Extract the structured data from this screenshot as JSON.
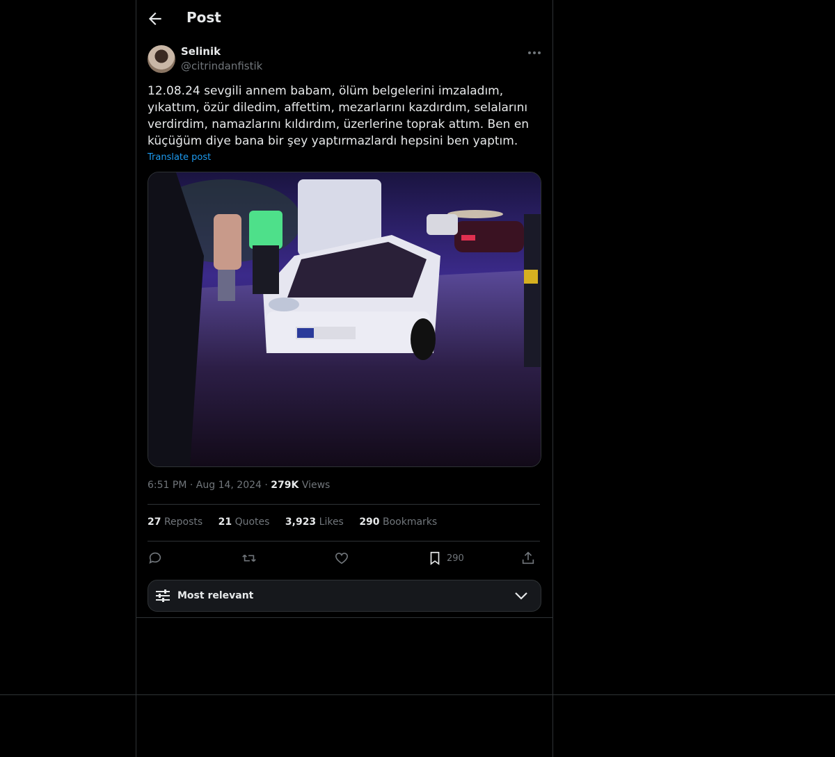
{
  "header": {
    "title": "Post"
  },
  "author": {
    "name": "Selinik",
    "handle": "@citrindanfistik"
  },
  "post": {
    "text": "12.08.24 sevgili annem babam, ölüm belgelerini imzaladım, yıkattım, özür diledim, affettim, mezarlarını kazdırdım, selalarını verdirdim, namazlarını kıldırdım, üzerlerine toprak attım. Ben en küçüğüm diye bana bir şey yaptırmazlardı hepsini ben yaptım.",
    "translate_label": "Translate post",
    "time": "6:51 PM",
    "date": "Aug 14, 2024",
    "views_count": "279K",
    "views_label": "Views"
  },
  "stats": {
    "reposts": {
      "count": "27",
      "label": "Reposts"
    },
    "quotes": {
      "count": "21",
      "label": "Quotes"
    },
    "likes": {
      "count": "3,923",
      "label": "Likes"
    },
    "bookmarks": {
      "count": "290",
      "label": "Bookmarks"
    }
  },
  "actions": {
    "bookmark_count": "290"
  },
  "sort": {
    "label": "Most relevant"
  },
  "colors": {
    "accent": "#1d9bf0",
    "muted": "#71767b",
    "border": "#2f3336"
  }
}
